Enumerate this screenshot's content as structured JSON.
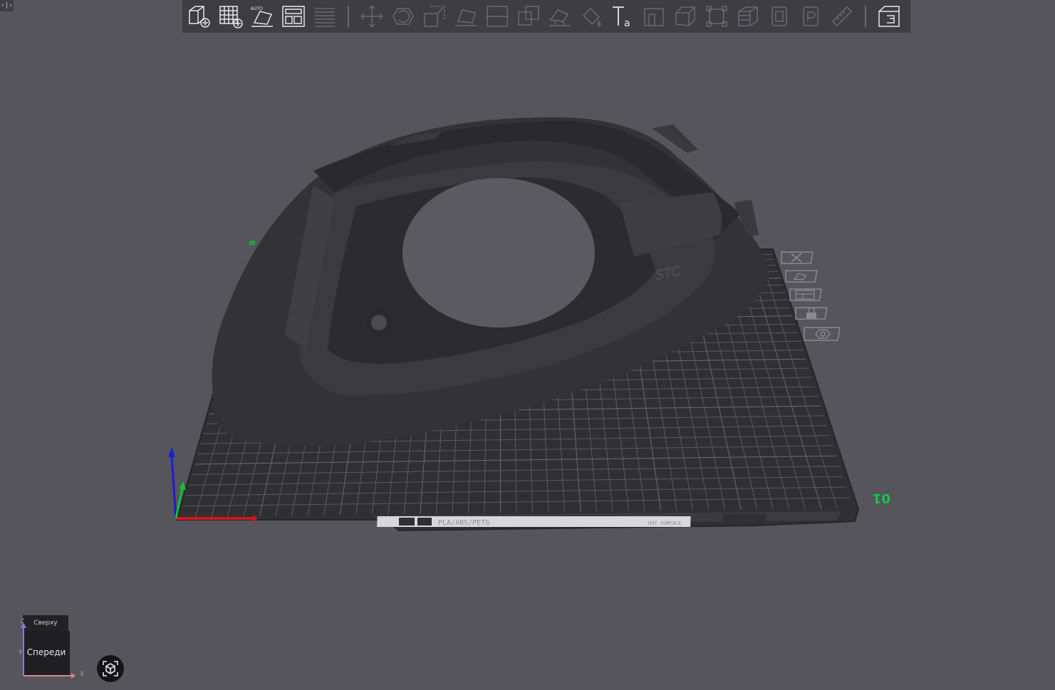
{
  "corner": {
    "label": "‹|›"
  },
  "toolbar": {
    "buttons": [
      {
        "icon": "add-model-icon",
        "state": "active"
      },
      {
        "icon": "add-plate-icon",
        "state": "active"
      },
      {
        "icon": "auto-orient-icon",
        "state": "active",
        "label": "AUTO"
      },
      {
        "icon": "arrange-icon",
        "state": "active"
      },
      {
        "icon": "split-plates-icon",
        "state": "disabled"
      },
      {
        "icon": "move-icon",
        "state": "disabled"
      },
      {
        "icon": "rotate-icon",
        "state": "disabled"
      },
      {
        "icon": "scale-icon",
        "state": "disabled"
      },
      {
        "icon": "lay-on-face-icon",
        "state": "disabled"
      },
      {
        "icon": "cut-icon",
        "state": "disabled"
      },
      {
        "icon": "boolean-icon",
        "state": "disabled"
      },
      {
        "icon": "support-paint-icon",
        "state": "disabled"
      },
      {
        "icon": "color-paint-icon",
        "state": "disabled"
      },
      {
        "icon": "text-icon",
        "state": "active"
      },
      {
        "icon": "emboss-icon",
        "state": "disabled"
      },
      {
        "icon": "brim-ears-icon",
        "state": "disabled"
      },
      {
        "icon": "mesh-boolean-icon",
        "state": "disabled"
      },
      {
        "icon": "layers-icon",
        "state": "disabled"
      },
      {
        "icon": "variable-height-icon",
        "state": "disabled"
      },
      {
        "icon": "seam-paint-icon",
        "state": "disabled"
      },
      {
        "icon": "fuzzy-skin-icon",
        "state": "disabled"
      },
      {
        "icon": "measure-icon",
        "state": "disabled"
      },
      {
        "icon": "assembly-view-icon",
        "state": "active"
      }
    ]
  },
  "plate": {
    "number": "01",
    "filament_label": "PLA/ABS/PETG",
    "surface_label": "HOT SURFACE"
  },
  "model": {
    "logo": "STC"
  },
  "side_tools": [
    {
      "icon": "delete-plate-icon"
    },
    {
      "icon": "orient-plate-icon"
    },
    {
      "icon": "arrange-plate-icon"
    },
    {
      "icon": "lock-plate-icon"
    },
    {
      "icon": "plate-settings-icon"
    }
  ],
  "view_cube": {
    "top": "Сверху",
    "front": "Спереди",
    "axis_z": "Z",
    "axis_y": "Y",
    "axis_x": "X"
  },
  "colors": {
    "background": "#55555b",
    "toolbar": "#3d3d42",
    "plate": "#303034",
    "grid": "#55555c",
    "model": "#333336",
    "axis_x": "#d2161b",
    "axis_y": "#11c231",
    "axis_z": "#1a1fd2",
    "plate_number": "#19c44a"
  }
}
